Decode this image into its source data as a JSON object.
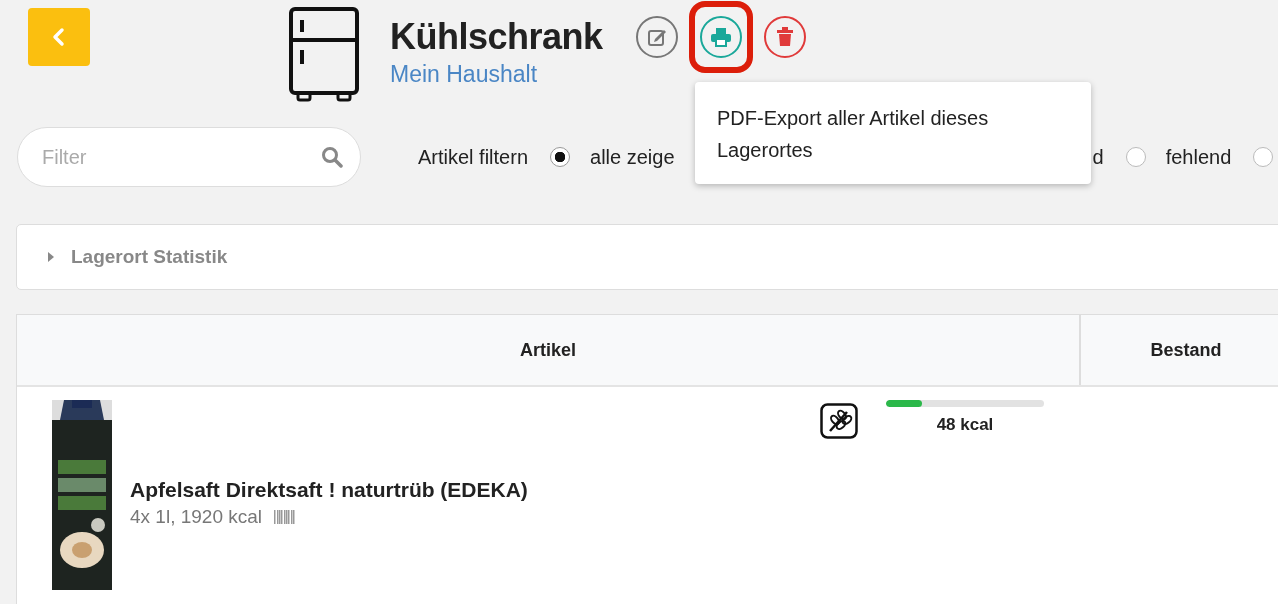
{
  "header": {
    "title": "Kühlschrank",
    "subtitle": "Mein Haushalt",
    "actions": [
      {
        "kind": "edit",
        "highlighted": false
      },
      {
        "kind": "print",
        "highlighted": true
      },
      {
        "kind": "delete",
        "highlighted": false
      }
    ]
  },
  "tooltip": {
    "text": "PDF-Export aller Artikel dieses Lagerortes"
  },
  "filter": {
    "placeholder": "Filter",
    "label": "Artikel filtern",
    "options": [
      {
        "label": "alle zeige",
        "selected": true
      },
      {
        "label": "d"
      },
      {
        "label": "fehlend",
        "selected": false
      },
      {
        "selected": false
      }
    ]
  },
  "statistics_panel": {
    "title": "Lagerort Statistik",
    "expanded": false
  },
  "table": {
    "columns": [
      "Artikel",
      "Bestand"
    ],
    "rows": [
      {
        "name": "Apfelsaft Direktsaft ! naturtrüb (EDEKA)",
        "details": "4x 1l, 1920 kcal",
        "level": 0.23,
        "reading": "48 kcal"
      }
    ]
  }
}
